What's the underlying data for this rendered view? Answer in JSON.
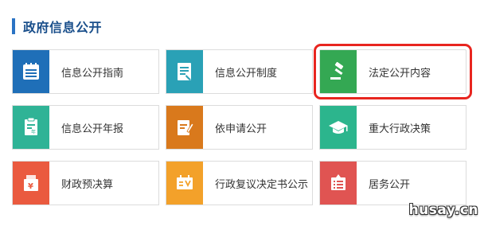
{
  "section": {
    "title": "政府信息公开"
  },
  "cards": [
    {
      "label": "信息公开指南",
      "icon": "list-book-icon",
      "color": "#1f6fb8"
    },
    {
      "label": "信息公开制度",
      "icon": "document-edit-icon",
      "color": "#2aa1b6"
    },
    {
      "label": "法定公开内容",
      "icon": "gavel-icon",
      "color": "#34a853"
    },
    {
      "label": "信息公开年报",
      "icon": "annual-report-icon",
      "color": "#2fb396"
    },
    {
      "label": "依申请公开",
      "icon": "write-form-icon",
      "color": "#d9791c"
    },
    {
      "label": "重大行政决策",
      "icon": "graduation-cap-icon",
      "color": "#2cb58d"
    },
    {
      "label": "财政预决算",
      "icon": "budget-yen-icon",
      "color": "#ea5a3f"
    },
    {
      "label": "行政复议决定书公示",
      "icon": "certificate-icon",
      "color": "#f3a12a"
    },
    {
      "label": "居务公开",
      "icon": "notice-board-icon",
      "color": "#e05452"
    }
  ],
  "watermark": "husay.cn"
}
